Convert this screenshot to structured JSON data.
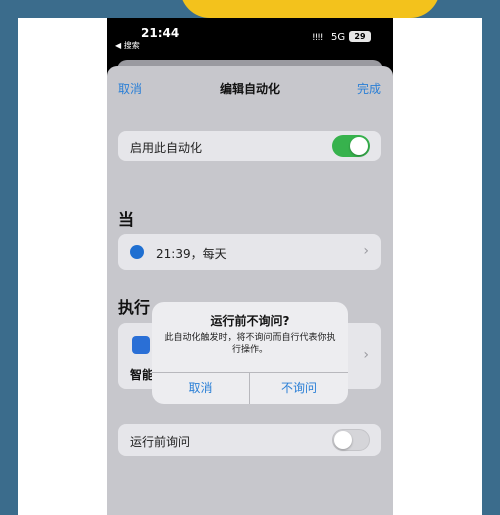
{
  "status_bar": {
    "time": "21:44",
    "back_label": "◀ 搜索",
    "signal": "!!!!",
    "network": "5G",
    "battery": "29"
  },
  "nav": {
    "cancel": "取消",
    "title": "编辑自动化",
    "done": "完成"
  },
  "enable_row": {
    "label": "启用此自动化",
    "toggle_on": true
  },
  "when_section": {
    "title": "当",
    "trigger": "21:39，每天"
  },
  "do_section": {
    "title": "执行",
    "action_label": "智能"
  },
  "ask_row": {
    "label": "运行前询问",
    "toggle_on": false
  },
  "dialog": {
    "title": "运行前不询问?",
    "message": "此自动化触发时，将不询问而自行代表你执行操作。",
    "cancel": "取消",
    "confirm": "不询问"
  },
  "colors": {
    "accent": "#2a7fd6",
    "toggle_on": "#37b24d",
    "frame": "#3b6c8c",
    "yellow": "#f3c21c"
  },
  "icons": {
    "clock": "clock-icon",
    "chevron": "chevron-right-icon",
    "app": "shortcut-app-icon"
  }
}
